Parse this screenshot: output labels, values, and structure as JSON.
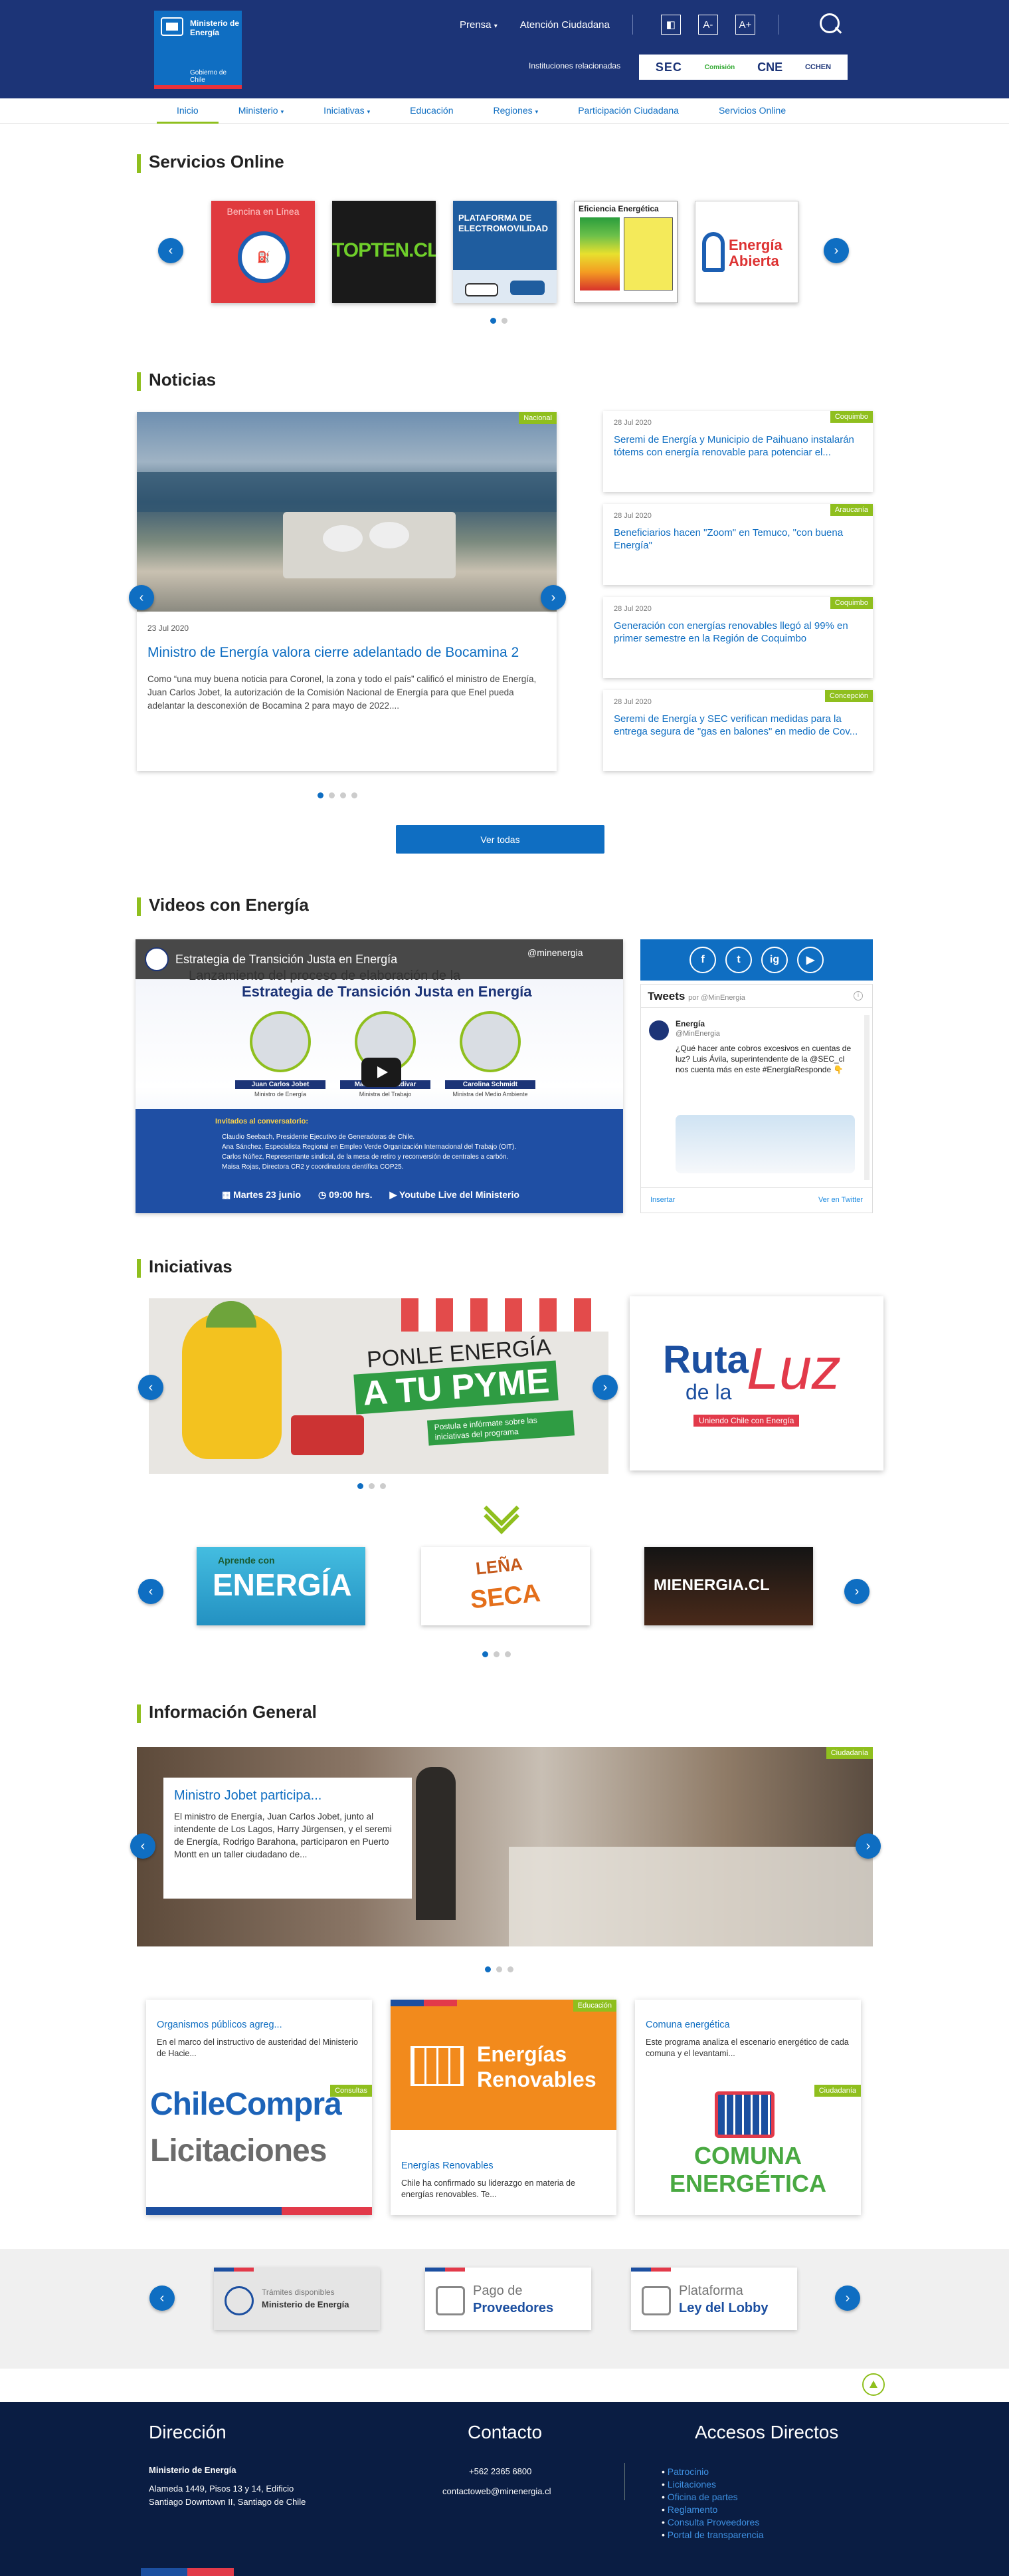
{
  "header": {
    "logo_line1": "Ministerio de",
    "logo_line2": "Energía",
    "logo_sub": "Gobierno de Chile",
    "nav": [
      "Prensa",
      "Atención Ciudadana"
    ],
    "access_icons": [
      "contrast-icon",
      "font-decrease-icon",
      "font-increase-icon"
    ],
    "access_labels": [
      "◧",
      "A-",
      "A+"
    ],
    "institutions_label": "Instituciones relacionadas",
    "institutions": [
      "SEC",
      "Comisión",
      "CNE",
      "CCHEN"
    ]
  },
  "mainnav": [
    {
      "label": "Inicio",
      "caret": false
    },
    {
      "label": "Ministerio",
      "caret": true
    },
    {
      "label": "Iniciativas",
      "caret": true
    },
    {
      "label": "Educación",
      "caret": false
    },
    {
      "label": "Regiones",
      "caret": true
    },
    {
      "label": "Participación Ciudadana",
      "caret": false
    },
    {
      "label": "Servicios Online",
      "caret": false
    }
  ],
  "servicios": {
    "title": "Servicios Online",
    "tiles": [
      "Bencina en Línea",
      "TOPTEN.CL",
      "PLATAFORMA DE ELECTROMOVILIDAD",
      "Eficiencia Energética",
      "Energía Abierta"
    ]
  },
  "noticias": {
    "title": "Noticias",
    "featured": {
      "tag": "Nacional",
      "date": "23 Jul 2020",
      "title": "Ministro de Energía valora cierre adelantado de Bocamina 2",
      "body": "Como “una muy buena noticia para Coronel, la zona y todo el país” calificó el ministro de Energía, Juan Carlos Jobet, la autorización de la Comisión Nacional de Energía para que Enel pueda adelantar la desconexión de Bocamina 2 para mayo de 2022...."
    },
    "side": [
      {
        "tag": "Coquimbo",
        "date": "28 Jul 2020",
        "title": "Seremi de Energía y Municipio de Paihuano instalarán tótems con energía renovable para potenciar el..."
      },
      {
        "tag": "Araucanía",
        "date": "28 Jul 2020",
        "title": "Beneficiarios hacen \"Zoom\" en Temuco, \"con buena Energía\""
      },
      {
        "tag": "Coquimbo",
        "date": "28 Jul 2020",
        "title": "Generación con energías renovables llegó al 99% en primer semestre en la Región de Coquimbo"
      },
      {
        "tag": "Concepción",
        "date": "28 Jul 2020",
        "title": "Seremi de Energía y SEC verifican medidas para la entrega segura de \"gas en balones\" en medio de Cov..."
      }
    ],
    "see_all": "Ver todas"
  },
  "videos": {
    "title": "Videos con Energía",
    "video_title": "Estrategia de Transición Justa en Energía",
    "handle": "@minenergia",
    "heading1": "Lanzamiento del proceso de elaboración de la",
    "heading2": "Estrategia de Transición Justa en Energía",
    "people": [
      {
        "name": "Juan Carlos Jobet",
        "role": "Ministro de Energía"
      },
      {
        "name": "María José Zaldívar",
        "role": "Ministra del Trabajo"
      },
      {
        "name": "Carolina Schmidt",
        "role": "Ministra del Medio Ambiente"
      }
    ],
    "guests_label": "Invitados al conversatorio:",
    "guests": [
      "Claudio Seebach, Presidente Ejecutivo de Generadoras de Chile.",
      "Ana Sánchez, Especialista Regional en Empleo Verde Organización Internacional del Trabajo (OIT).",
      "Carlos Núñez, Representante sindical, de la mesa de retiro y reconversión de centrales a carbón.",
      "Maisa Rojas, Directora CR2 y coordinadora científica COP25."
    ],
    "date": "Martes 23 junio",
    "time": "09:00 hrs.",
    "channel": "Youtube Live del Ministerio"
  },
  "social": [
    "f",
    "t",
    "ig",
    "▶"
  ],
  "tweets": {
    "header": "Tweets",
    "by": "por @MinEnergia",
    "user": "Energía",
    "handle": "@MinEnergia",
    "text": "¿Qué hacer ante cobros excesivos en cuentas de luz? Luis Ávila, superintendente de la @SEC_cl nos cuenta más en este #EnergíaResponde 👇",
    "embed": "Insertar",
    "view": "Ver en Twitter"
  },
  "iniciativas": {
    "title": "Iniciativas",
    "main_line1": "PONLE ENERGÍA",
    "main_line2": "A TU PYME",
    "main_sub": "Postula e infórmate sobre las iniciativas del programa",
    "side_line1": "Ruta",
    "side_line2": "de la",
    "side_line3": "Luz",
    "side_sub": "Uniendo Chile con Energía",
    "minis": [
      {
        "top": "Aprende con",
        "main": "ENERGÍA"
      },
      {
        "top": "LEÑA",
        "main": "SECA"
      },
      {
        "top": "",
        "main": "MIENERGIA.CL"
      }
    ]
  },
  "info": {
    "title": "Información General",
    "slide_tag": "Ciudadanía",
    "slide_title": "Ministro Jobet participa...",
    "slide_body": "El ministro de Energía, Juan Carlos Jobet, junto al intendente de Los Lagos, Harry Jürgensen, y el seremi de Energía, Rodrigo Barahona, participaron en Puerto Montt en un taller ciudadano de...",
    "cards": [
      {
        "title": "Organismos públicos agreg...",
        "body": "En el marco del instructivo de austeridad del Ministerio de Hacie...",
        "tag": "Consultas",
        "img1": "ChileCompra",
        "img2": "Licitaciones"
      },
      {
        "title": "Energías Renovables",
        "body": "Chile ha confirmado su liderazgo en materia de energías renovables. Te...",
        "tag": "Educación",
        "img1": "Energías",
        "img2": "Renovables"
      },
      {
        "title": "Comuna energética",
        "body": "Este programa analiza el escenario energético de cada comuna y el levantami...",
        "tag": "Ciudadanía",
        "img1": "COMUNA",
        "img2": "ENERGÉTICA"
      }
    ]
  },
  "portales": [
    {
      "l1": "Trámites disponibles",
      "l2": "Ministerio de Energía"
    },
    {
      "l1": "Pago de",
      "l2": "Proveedores"
    },
    {
      "l1": "Plataforma",
      "l2": "Ley del Lobby"
    }
  ],
  "footer": {
    "dir_title": "Dirección",
    "dir_name": "Ministerio de Energía",
    "dir_addr1": "Alameda 1449, Pisos 13 y 14, Edificio",
    "dir_addr2": "Santiago Downtown II, Santiago de Chile",
    "contact_title": "Contacto",
    "phone": "+562 2365 6800",
    "email": "contactoweb@minenergia.cl",
    "access_title": "Accesos Directos",
    "links": [
      "Patrocinio",
      "Licitaciones",
      "Oficina de partes",
      "Reglamento",
      "Consulta Proveedores",
      "Portal de transparencia"
    ]
  },
  "colors": {
    "brand_blue": "#0f6ec2",
    "header_navy": "#1c3477",
    "accent_green": "#8fbf1e",
    "footer_navy": "#0a1d43",
    "flag_red": "#e8313a"
  }
}
